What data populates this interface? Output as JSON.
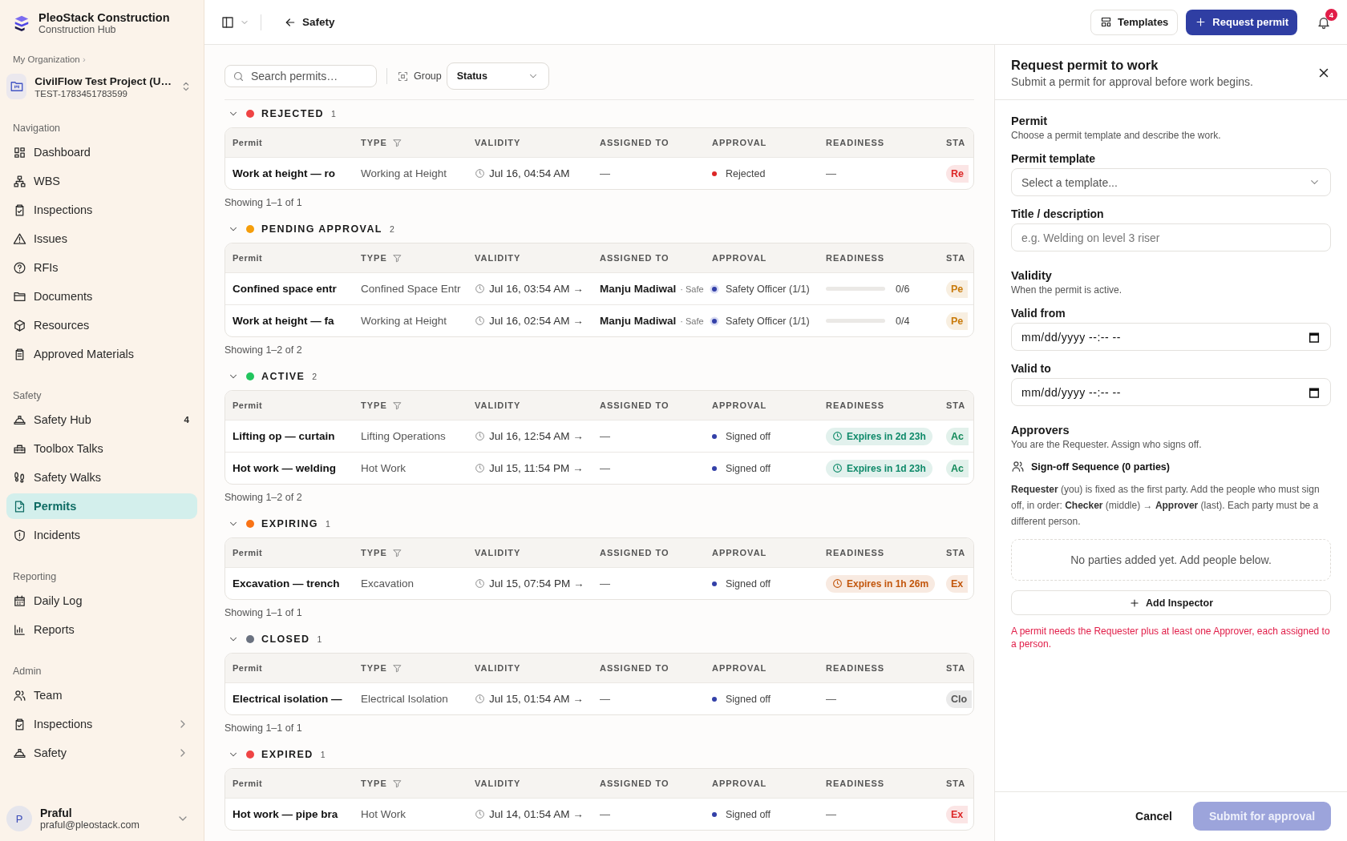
{
  "brand": {
    "name": "PleoStack Construction",
    "subtitle": "Construction Hub"
  },
  "org": {
    "label": "My Organization",
    "separator": "›"
  },
  "project": {
    "name": "CivilFlow Test Project (U…",
    "code": "TEST-1783451783599"
  },
  "sidebar": [
    {
      "title": "Navigation",
      "items": [
        {
          "label": "Dashboard",
          "selected": false,
          "submenu": false
        },
        {
          "label": "WBS",
          "selected": false,
          "submenu": false
        },
        {
          "label": "Inspections",
          "selected": false,
          "submenu": false
        },
        {
          "label": "Issues",
          "selected": false,
          "submenu": false
        },
        {
          "label": "RFIs",
          "selected": false,
          "submenu": false
        },
        {
          "label": "Documents",
          "selected": false,
          "submenu": false
        },
        {
          "label": "Resources",
          "selected": false,
          "submenu": false
        },
        {
          "label": "Approved Materials",
          "selected": false,
          "submenu": false
        }
      ]
    },
    {
      "title": "Safety",
      "items": [
        {
          "label": "Safety Hub",
          "selected": false,
          "submenu": false,
          "badge": "4"
        },
        {
          "label": "Toolbox Talks",
          "selected": false,
          "submenu": false
        },
        {
          "label": "Safety Walks",
          "selected": false,
          "submenu": false
        },
        {
          "label": "Permits",
          "selected": true,
          "submenu": false
        },
        {
          "label": "Incidents",
          "selected": false,
          "submenu": false
        }
      ]
    },
    {
      "title": "Reporting",
      "items": [
        {
          "label": "Daily Log",
          "selected": false,
          "submenu": false
        },
        {
          "label": "Reports",
          "selected": false,
          "submenu": false
        }
      ]
    },
    {
      "title": "Admin",
      "items": [
        {
          "label": "Team",
          "selected": false,
          "submenu": false
        },
        {
          "label": "Inspections",
          "selected": false,
          "submenu": true
        },
        {
          "label": "Safety",
          "selected": false,
          "submenu": true
        }
      ]
    }
  ],
  "user": {
    "initial": "P",
    "name": "Praful",
    "email": "praful@pleostack.com"
  },
  "topbar": {
    "back": "Safety",
    "buttons": [
      {
        "label": "Templates",
        "kind": "secondary"
      },
      {
        "label": "Request permit",
        "kind": "primary"
      }
    ],
    "notifications": "4"
  },
  "toolbar": {
    "search": {
      "placeholder": "Search permits…"
    },
    "group_label": "Group",
    "group_select": "Status"
  },
  "groups": [
    {
      "title": "REJECTED",
      "color": "#ef4444",
      "count": "1",
      "expanded": true,
      "columns": [
        {
          "label": "Permit",
          "filter": false
        },
        {
          "label": "TYPE",
          "filter": true
        },
        {
          "label": "VALIDITY",
          "filter": false
        },
        {
          "label": "ASSIGNED TO",
          "filter": false
        },
        {
          "label": "APPROVAL",
          "filter": false
        },
        {
          "label": "READINESS",
          "filter": false
        },
        {
          "label": "STA",
          "filter": false
        }
      ],
      "rows": [
        {
          "permit": "Work at height — ro",
          "type": "Working at Height",
          "validity": "Jul 16, 04:54 AM",
          "assigned": {
            "kind": "none",
            "text": "—"
          },
          "approval": {
            "kind": "dot",
            "color": "#dc2626",
            "text": "Rejected"
          },
          "readiness": {
            "kind": "none",
            "text": "—"
          },
          "status": {
            "text": "Re",
            "color": "#dc2626"
          }
        }
      ],
      "showing": "Showing 1–1 of 1"
    },
    {
      "title": "PENDING APPROVAL",
      "color": "#f59e0b",
      "count": "2",
      "expanded": true,
      "columns": [
        {
          "label": "Permit",
          "filter": false
        },
        {
          "label": "TYPE",
          "filter": true
        },
        {
          "label": "VALIDITY",
          "filter": false
        },
        {
          "label": "ASSIGNED TO",
          "filter": false
        },
        {
          "label": "APPROVAL",
          "filter": false
        },
        {
          "label": "READINESS",
          "filter": false
        },
        {
          "label": "STA",
          "filter": false
        }
      ],
      "rows": [
        {
          "permit": "Confined space entr",
          "type": "Confined Space Entr",
          "validity": "Jul 16, 03:54 AM →",
          "assigned": {
            "kind": "person",
            "name": "Manju Madiwal",
            "role": "· Safe"
          },
          "approval": {
            "kind": "ring",
            "color": "#3340a8",
            "text": "Safety Officer (1/1)"
          },
          "readiness": {
            "kind": "progress",
            "level": 0,
            "text": "0/6"
          },
          "status": {
            "text": "Pe",
            "color": "#c97a0a"
          }
        },
        {
          "permit": "Work at height — fa",
          "type": "Working at Height",
          "validity": "Jul 16, 02:54 AM →",
          "assigned": {
            "kind": "person",
            "name": "Manju Madiwal",
            "role": "· Safe"
          },
          "approval": {
            "kind": "ring",
            "color": "#3340a8",
            "text": "Safety Officer (1/1)"
          },
          "readiness": {
            "kind": "progress",
            "level": 0,
            "text": "0/4"
          },
          "status": {
            "text": "Pe",
            "color": "#c97a0a"
          }
        }
      ],
      "showing": "Showing 1–2 of 2"
    },
    {
      "title": "ACTIVE",
      "color": "#22c55e",
      "count": "2",
      "expanded": true,
      "columns": [
        {
          "label": "Permit",
          "filter": false
        },
        {
          "label": "TYPE",
          "filter": true
        },
        {
          "label": "VALIDITY",
          "filter": false
        },
        {
          "label": "ASSIGNED TO",
          "filter": false
        },
        {
          "label": "APPROVAL",
          "filter": false
        },
        {
          "label": "READINESS",
          "filter": false
        },
        {
          "label": "STA",
          "filter": false
        }
      ],
      "rows": [
        {
          "permit": "Lifting op — curtain",
          "type": "Lifting Operations",
          "validity": "Jul 16, 12:54 AM →",
          "assigned": {
            "kind": "none",
            "text": "—"
          },
          "approval": {
            "kind": "dot",
            "color": "#3340a8",
            "text": "Signed off"
          },
          "readiness": {
            "kind": "badge",
            "color": "#0f8a6a",
            "text": "Expires in 2d 23h"
          },
          "status": {
            "text": "Ac",
            "color": "#138a5a"
          }
        },
        {
          "permit": "Hot work — welding",
          "type": "Hot Work",
          "validity": "Jul 15, 11:54 PM →",
          "assigned": {
            "kind": "none",
            "text": "—"
          },
          "approval": {
            "kind": "dot",
            "color": "#3340a8",
            "text": "Signed off"
          },
          "readiness": {
            "kind": "badge",
            "color": "#0f8a6a",
            "text": "Expires in 1d 23h"
          },
          "status": {
            "text": "Ac",
            "color": "#138a5a"
          }
        }
      ],
      "showing": "Showing 1–2 of 2"
    },
    {
      "title": "EXPIRING",
      "color": "#f97316",
      "count": "1",
      "expanded": true,
      "columns": [
        {
          "label": "Permit",
          "filter": false
        },
        {
          "label": "TYPE",
          "filter": true
        },
        {
          "label": "VALIDITY",
          "filter": false
        },
        {
          "label": "ASSIGNED TO",
          "filter": false
        },
        {
          "label": "APPROVAL",
          "filter": false
        },
        {
          "label": "READINESS",
          "filter": false
        },
        {
          "label": "STA",
          "filter": false
        }
      ],
      "rows": [
        {
          "permit": "Excavation — trench",
          "type": "Excavation",
          "validity": "Jul 15, 07:54 PM →",
          "assigned": {
            "kind": "none",
            "text": "—"
          },
          "approval": {
            "kind": "dot",
            "color": "#3340a8",
            "text": "Signed off"
          },
          "readiness": {
            "kind": "badge",
            "color": "#c2560c",
            "text": "Expires in 1h 26m"
          },
          "status": {
            "text": "Ex",
            "color": "#c2560c"
          }
        }
      ],
      "showing": "Showing 1–1 of 1"
    },
    {
      "title": "CLOSED",
      "color": "#6b7280",
      "count": "1",
      "expanded": true,
      "columns": [
        {
          "label": "Permit",
          "filter": false
        },
        {
          "label": "TYPE",
          "filter": true
        },
        {
          "label": "VALIDITY",
          "filter": false
        },
        {
          "label": "ASSIGNED TO",
          "filter": false
        },
        {
          "label": "APPROVAL",
          "filter": false
        },
        {
          "label": "READINESS",
          "filter": false
        },
        {
          "label": "STA",
          "filter": false
        }
      ],
      "rows": [
        {
          "permit": "Electrical isolation —",
          "type": "Electrical Isolation",
          "validity": "Jul 15, 01:54 AM →",
          "assigned": {
            "kind": "none",
            "text": "—"
          },
          "approval": {
            "kind": "dot",
            "color": "#3340a8",
            "text": "Signed off"
          },
          "readiness": {
            "kind": "none",
            "text": "—"
          },
          "status": {
            "text": "Clo",
            "color": "#555555"
          }
        }
      ],
      "showing": "Showing 1–1 of 1"
    },
    {
      "title": "EXPIRED",
      "color": "#ef4444",
      "count": "1",
      "expanded": true,
      "columns": [
        {
          "label": "Permit",
          "filter": false
        },
        {
          "label": "TYPE",
          "filter": true
        },
        {
          "label": "VALIDITY",
          "filter": false
        },
        {
          "label": "ASSIGNED TO",
          "filter": false
        },
        {
          "label": "APPROVAL",
          "filter": false
        },
        {
          "label": "READINESS",
          "filter": false
        },
        {
          "label": "STA",
          "filter": false
        }
      ],
      "rows": [
        {
          "permit": "Hot work — pipe bra",
          "type": "Hot Work",
          "validity": "Jul 14, 01:54 AM →",
          "assigned": {
            "kind": "none",
            "text": "—"
          },
          "approval": {
            "kind": "dot",
            "color": "#3340a8",
            "text": "Signed off"
          },
          "readiness": {
            "kind": "none",
            "text": "—"
          },
          "status": {
            "text": "Ex",
            "color": "#dc2626"
          }
        }
      ]
    }
  ],
  "panel": {
    "title": "Request permit to work",
    "subtitle": "Submit a permit for approval before work begins.",
    "sections": [
      {
        "heading": "Permit",
        "hint": "Choose a permit template and describe the work.",
        "fields": [
          {
            "kind": "select",
            "label": "Permit template",
            "placeholder": "Select a template..."
          },
          {
            "kind": "text",
            "label": "Title / description",
            "placeholder": "e.g. Welding on level 3 riser"
          }
        ]
      },
      {
        "heading": "Validity",
        "hint": "When the permit is active.",
        "fields": [
          {
            "kind": "datetime",
            "label": "Valid from",
            "placeholder": "mm/dd/yyyy --:-- --"
          },
          {
            "kind": "datetime",
            "label": "Valid to",
            "placeholder": "mm/dd/yyyy --:-- --"
          }
        ]
      }
    ],
    "approvers": {
      "heading": "Approvers",
      "hint": "You are the Requester. Assign who signs off.",
      "sequence": "Sign-off Sequence (0 parties)",
      "explanation": "**Requester** (you) is fixed as the first party. Add the people who must sign off, in order: **Checker** (middle) → **Approver** (last). Each party must be a different person.",
      "empty": "No parties added yet. Add people below.",
      "add_button": "Add Inspector",
      "error": "A permit needs the Requester plus at least one Approver, each assigned to a person."
    },
    "cancel": "Cancel",
    "submit": {
      "label": "Submit for approval",
      "disabled": true
    }
  }
}
